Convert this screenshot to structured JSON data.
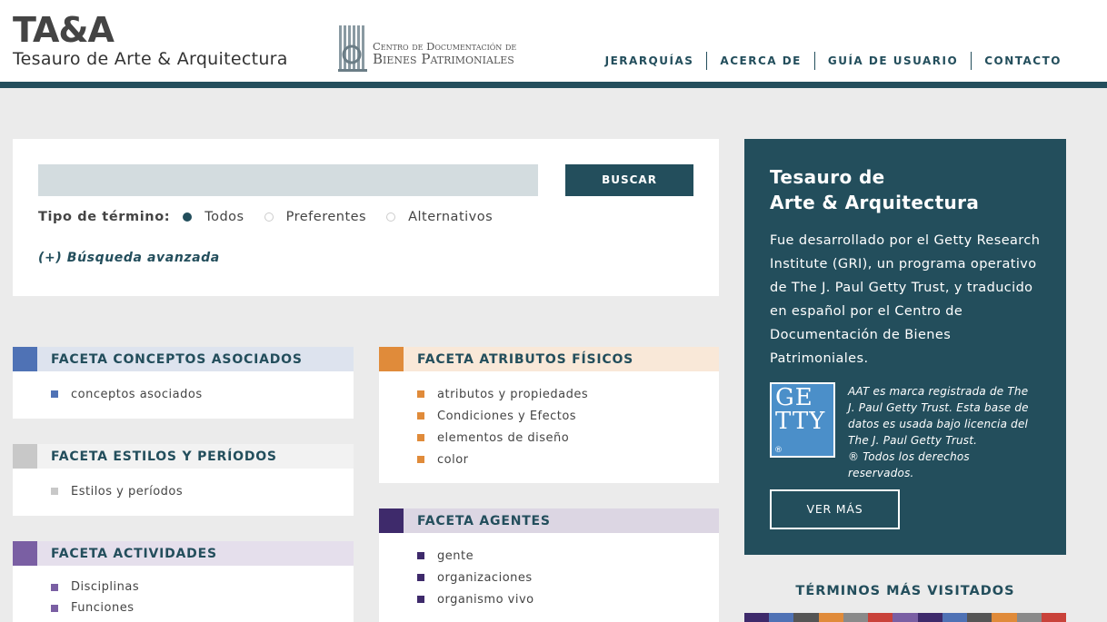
{
  "header": {
    "brand_abbr": "TA&A",
    "brand_name": "Tesauro de Arte & Arquitectura",
    "partner_line1": "Centro de Documentación de",
    "partner_line2": "Bienes Patrimoniales",
    "nav": [
      "JERARQUÍAS",
      "ACERCA DE",
      "GUÍA DE USUARIO",
      "CONTACTO"
    ]
  },
  "search": {
    "placeholder": "",
    "button_label": "BUSCAR",
    "term_type_label": "Tipo de término:",
    "options": [
      "Todos",
      "Preferentes",
      "Alternativos"
    ],
    "selected": "Todos",
    "advanced_link": "(+) Búsqueda avanzada"
  },
  "facets": {
    "conceptos": {
      "title": "FACETA CONCEPTOS ASOCIADOS",
      "color": "#4f72b5",
      "bg": "#dde3ee",
      "items": [
        "conceptos asociados"
      ]
    },
    "estilos": {
      "title": "FACETA ESTILOS Y PERÍODOS",
      "color": "#c8c8c8",
      "bg": "#f2f2f2",
      "items": [
        "Estilos y períodos"
      ]
    },
    "actividades": {
      "title": "FACETA ACTIVIDADES",
      "color": "#7a5fa3",
      "bg": "#e5dfec",
      "items": [
        "Disciplinas",
        "Funciones"
      ]
    },
    "atributos": {
      "title": "FACETA ATRIBUTOS FÍSICOS",
      "color": "#e08b3a",
      "bg": "#f9e8d8",
      "items": [
        "atributos y propiedades",
        "Condiciones y Efectos",
        "elementos de diseño",
        "color"
      ]
    },
    "agentes": {
      "title": "FACETA AGENTES",
      "color": "#3e2a6b",
      "bg": "#dcd6e3",
      "items": [
        "gente",
        "organizaciones",
        "organismo vivo"
      ]
    }
  },
  "info": {
    "title_line1": "Tesauro de",
    "title_line2": "Arte & Arquitectura",
    "description": "Fue desarrollado por el Getty Research Institute (GRI), un programa operativo de The J. Paul Getty Trust, y traducido en español por el Centro de Documentación de Bienes Patrimoniales.",
    "logo_text": "GETTY",
    "logo_reg": "®",
    "note_line1": "AAT es marca registrada de The J. Paul Getty Trust. Esta base de datos es usada bajo licencia del The J. Paul Getty Trust.",
    "note_line2": "® Todos los derechos reservados.",
    "button_label": "VER MÁS"
  },
  "top_terms": {
    "title": "TÉRMINOS MÁS VISITADOS",
    "strip_colors": [
      "#3e2a6b",
      "#4f72b5",
      "#555555",
      "#e08b3a",
      "#8a8a8a",
      "#c9423a",
      "#7a5fa3",
      "#3e2a6b",
      "#4f72b5",
      "#555555",
      "#e08b3a",
      "#8a8a8a",
      "#c9423a"
    ]
  },
  "colors": {
    "primary": "#234e5c",
    "background": "#ebebeb"
  }
}
